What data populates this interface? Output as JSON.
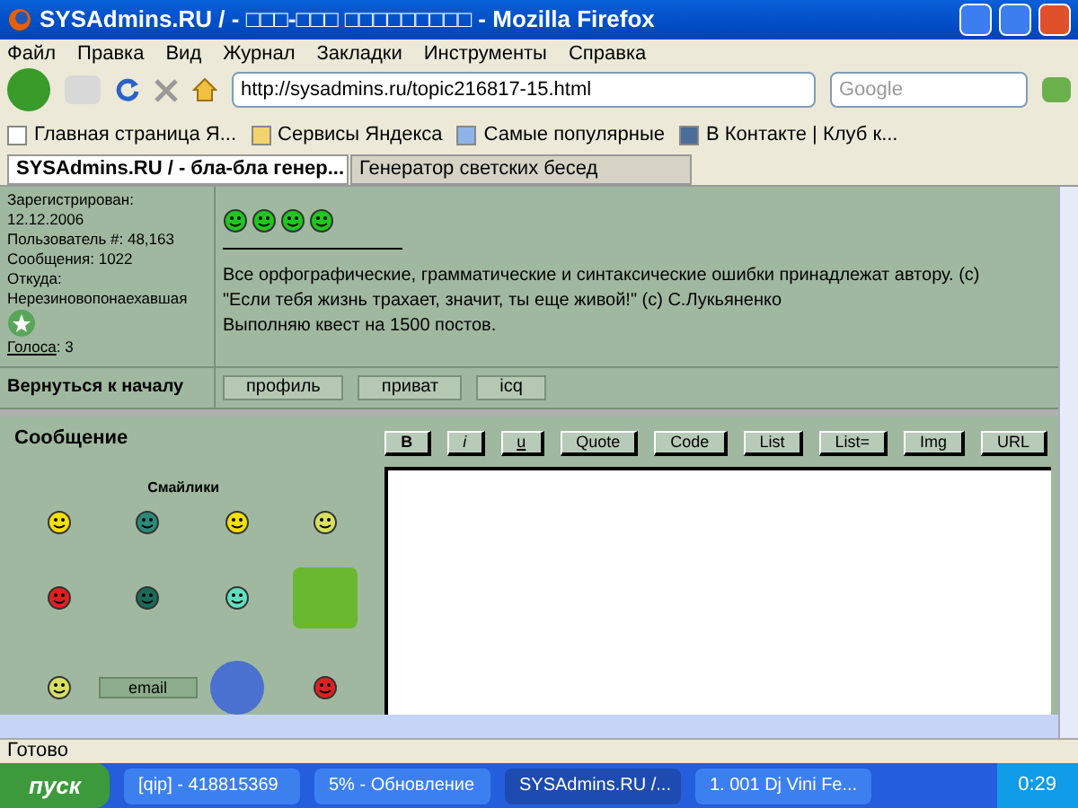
{
  "window": {
    "title": "SYSAdmins.RU / - □□□-□□□ □□□□□□□□□ - Mozilla Firefox"
  },
  "menu": [
    "Файл",
    "Правка",
    "Вид",
    "Журнал",
    "Закладки",
    "Инструменты",
    "Справка"
  ],
  "address": {
    "value": "http://sysadmins.ru/topic216817-15.html"
  },
  "search": {
    "placeholder": "Google"
  },
  "bookmarks": [
    {
      "label": "Главная страница Я...",
      "kind": "page"
    },
    {
      "label": "Сервисы Яндекса",
      "kind": "folder"
    },
    {
      "label": "Самые популярные",
      "kind": "search"
    },
    {
      "label": "В Контакте | Клуб к...",
      "kind": "vk"
    }
  ],
  "tabs": [
    {
      "label": "SYSAdmins.RU / - бла-бла генер...",
      "selected": true
    },
    {
      "label": "Генератор светских бесед",
      "selected": false
    }
  ],
  "user": {
    "fields": [
      "Зарегистрирован:",
      "12.12.2006",
      "Пользователь #: 48,163",
      "Сообщения: 1022",
      "Откуда:",
      "Нерезиновопонаехавшая"
    ],
    "votes_link": "Голоса",
    "votes": ": 3"
  },
  "post": {
    "signature": [
      "Все орфографические, грамматические и синтаксические ошибки принадлежат автору. (с)",
      "\"Если тебя жизнь трахает, значит, ты еще живой!\" (с) С.Лукьяненко",
      "Выполняю квест на 1500 постов."
    ]
  },
  "back_to_top": "Вернуться к началу",
  "profile_buttons": [
    "профиль",
    "приват",
    "icq"
  ],
  "message": {
    "title": "Сообщение",
    "smileys_title": "Смайлики",
    "email_button": "email"
  },
  "format_buttons": [
    "B",
    "i",
    "u",
    "Quote",
    "Code",
    "List",
    "List=",
    "Img",
    "URL"
  ],
  "status_bar": "Готово",
  "taskbar": {
    "start": "пуск",
    "items": [
      {
        "label": "[qip] - 418815369",
        "selected": false
      },
      {
        "label": "5% - Обновление",
        "selected": false
      },
      {
        "label": "SYSAdmins.RU /...",
        "selected": true
      },
      {
        "label": "1. 001 Dj Vini Fe...",
        "selected": false
      }
    ],
    "clock": "0:29"
  }
}
